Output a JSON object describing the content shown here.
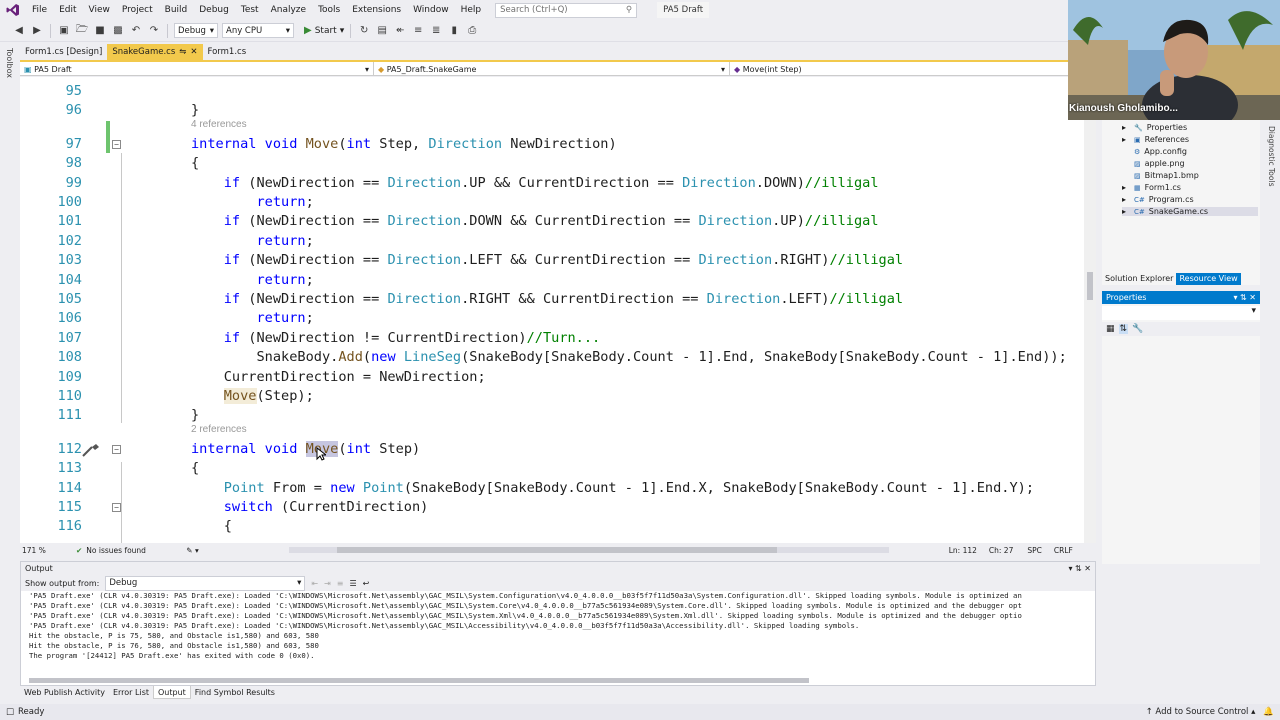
{
  "menubar": {
    "items": [
      "File",
      "Edit",
      "View",
      "Project",
      "Build",
      "Debug",
      "Test",
      "Analyze",
      "Tools",
      "Extensions",
      "Window",
      "Help"
    ],
    "search_placeholder": "Search (Ctrl+Q)",
    "solution_name": "PA5 Draft"
  },
  "toolbar": {
    "config": "Debug",
    "platform": "Any CPU",
    "start_label": "Start"
  },
  "toolbox_label": "Toolbox",
  "tabs": [
    {
      "label": "Form1.cs [Design]"
    },
    {
      "label": "SnakeGame.cs",
      "active": true
    },
    {
      "label": "Form1.cs"
    }
  ],
  "navbar": {
    "project": "PA5 Draft",
    "class": "PA5_Draft.SnakeGame",
    "member": "Move(int Step)"
  },
  "editor": {
    "lines": [
      {
        "n": "95",
        "html": "                "
      },
      {
        "n": "96",
        "html": "}"
      },
      {
        "lens": "4 references"
      },
      {
        "n": "97",
        "html": "<span class='kw'>internal</span> <span class='kw'>void</span> <span class='me'>Move</span>(<span class='kw'>int</span> Step, <span class='ty'>Direction</span> NewDirection)"
      },
      {
        "n": "98",
        "html": "{"
      },
      {
        "n": "99",
        "html": "    <span class='kw'>if</span> (NewDirection == <span class='ty'>Direction</span>.UP &amp;&amp; CurrentDirection == <span class='ty'>Direction</span>.DOWN)<span class='cm'>//illigal</span>"
      },
      {
        "n": "100",
        "html": "        <span class='kw'>return</span>;"
      },
      {
        "n": "101",
        "html": "    <span class='kw'>if</span> (NewDirection == <span class='ty'>Direction</span>.DOWN &amp;&amp; CurrentDirection == <span class='ty'>Direction</span>.UP)<span class='cm'>//illigal</span>"
      },
      {
        "n": "102",
        "html": "        <span class='kw'>return</span>;"
      },
      {
        "n": "103",
        "html": "    <span class='kw'>if</span> (NewDirection == <span class='ty'>Direction</span>.LEFT &amp;&amp; CurrentDirection == <span class='ty'>Direction</span>.RIGHT)<span class='cm'>//illigal</span>"
      },
      {
        "n": "104",
        "html": "        <span class='kw'>return</span>;"
      },
      {
        "n": "105",
        "html": "    <span class='kw'>if</span> (NewDirection == <span class='ty'>Direction</span>.RIGHT &amp;&amp; CurrentDirection == <span class='ty'>Direction</span>.LEFT)<span class='cm'>//illigal</span>"
      },
      {
        "n": "106",
        "html": "        <span class='kw'>return</span>;"
      },
      {
        "n": "107",
        "html": "    <span class='kw'>if</span> (NewDirection != CurrentDirection)<span class='cm'>//Turn...</span>"
      },
      {
        "n": "108",
        "html": "        SnakeBody.<span class='me'>Add</span>(<span class='kw'>new</span> <span class='ty'>LineSeg</span>(SnakeBody[SnakeBody.Count - 1].End, SnakeBody[SnakeBody.Count - 1].End));"
      },
      {
        "n": "109",
        "html": "    CurrentDirection = NewDirection;"
      },
      {
        "n": "110",
        "html": "    <span class='me' style='background:#f3ecd8'>Move</span>(Step);"
      },
      {
        "n": "111",
        "html": "}"
      },
      {
        "lens": "2 references"
      },
      {
        "n": "112",
        "html": "<span class='kw'>internal</span> <span class='kw'>void</span> <span class='me hl'>Move</span>(<span class='kw'>int</span> Step)"
      },
      {
        "n": "113",
        "html": "{"
      },
      {
        "n": "114",
        "html": "    <span class='ty'>Point</span> From = <span class='kw'>new</span> <span class='ty'>Point</span>(SnakeBody[SnakeBody.Count - 1].End.X, SnakeBody[SnakeBody.Count - 1].End.Y);"
      },
      {
        "n": "115",
        "html": "    <span class='kw'>switch</span> (CurrentDirection)"
      },
      {
        "n": "116",
        "html": "    {"
      }
    ]
  },
  "editor_status": {
    "zoom": "171 %",
    "issues": "No issues found",
    "ln": "Ln: 112",
    "ch": "Ch: 27",
    "spc": "SPC",
    "crlf": "CRLF"
  },
  "output": {
    "title": "Output",
    "show_from_label": "Show output from:",
    "source": "Debug",
    "lines": [
      "'PA5 Draft.exe' (CLR v4.0.30319: PA5 Draft.exe): Loaded 'C:\\WINDOWS\\Microsoft.Net\\assembly\\GAC_MSIL\\System.Configuration\\v4.0_4.0.0.0__b03f5f7f11d50a3a\\System.Configuration.dll'. Skipped loading symbols. Module is optimized an",
      "'PA5 Draft.exe' (CLR v4.0.30319: PA5 Draft.exe): Loaded 'C:\\WINDOWS\\Microsoft.Net\\assembly\\GAC_MSIL\\System.Core\\v4.0_4.0.0.0__b77a5c561934e089\\System.Core.dll'. Skipped loading symbols. Module is optimized and the debugger opt",
      "'PA5 Draft.exe' (CLR v4.0.30319: PA5 Draft.exe): Loaded 'C:\\WINDOWS\\Microsoft.Net\\assembly\\GAC_MSIL\\System.Xml\\v4.0_4.0.0.0__b77a5c561934e089\\System.Xml.dll'. Skipped loading symbols. Module is optimized and the debugger optio",
      "'PA5 Draft.exe' (CLR v4.0.30319: PA5 Draft.exe): Loaded 'C:\\WINDOWS\\Microsoft.Net\\assembly\\GAC_MSIL\\Accessibility\\v4.0_4.0.0.0__b03f5f7f11d50a3a\\Accessibility.dll'. Skipped loading symbols.",
      "Hit the obstacle, P is 75, 580, and Obstacle is1,580) and 603, 580",
      "Hit the obstacle, P is 76, 580, and Obstacle is1,580) and 603, 580",
      "The program '[24412] PA5 Draft.exe' has exited with code 0 (0x0)."
    ]
  },
  "bottom_tabs": [
    "Web Publish Activity",
    "Error List",
    "Output",
    "Find Symbol Results"
  ],
  "solution_explorer": {
    "items": [
      {
        "label": "Properties",
        "icon": "wrench-icon"
      },
      {
        "label": "References",
        "icon": "references-icon"
      },
      {
        "label": "App.config",
        "icon": "config-icon"
      },
      {
        "label": "apple.png",
        "icon": "image-icon"
      },
      {
        "label": "Bitmap1.bmp",
        "icon": "image-icon"
      },
      {
        "label": "Form1.cs",
        "icon": "form-icon"
      },
      {
        "label": "Program.cs",
        "icon": "cs-icon"
      },
      {
        "label": "SnakeGame.cs",
        "icon": "cs-icon"
      }
    ],
    "tabs": [
      "Solution Explorer",
      "Resource View"
    ]
  },
  "properties": {
    "title": "Properties"
  },
  "diagnostic_label": "Diagnostic Tools",
  "webcam": {
    "name": "Kianoush Gholamibo..."
  },
  "statusbar": {
    "left": "Ready",
    "right": "Add to Source Control"
  },
  "colors": {
    "accent": "#007acc",
    "active_tab": "#f2c94c",
    "keyword": "#0000ff",
    "type": "#2b91af",
    "comment": "#008000"
  }
}
